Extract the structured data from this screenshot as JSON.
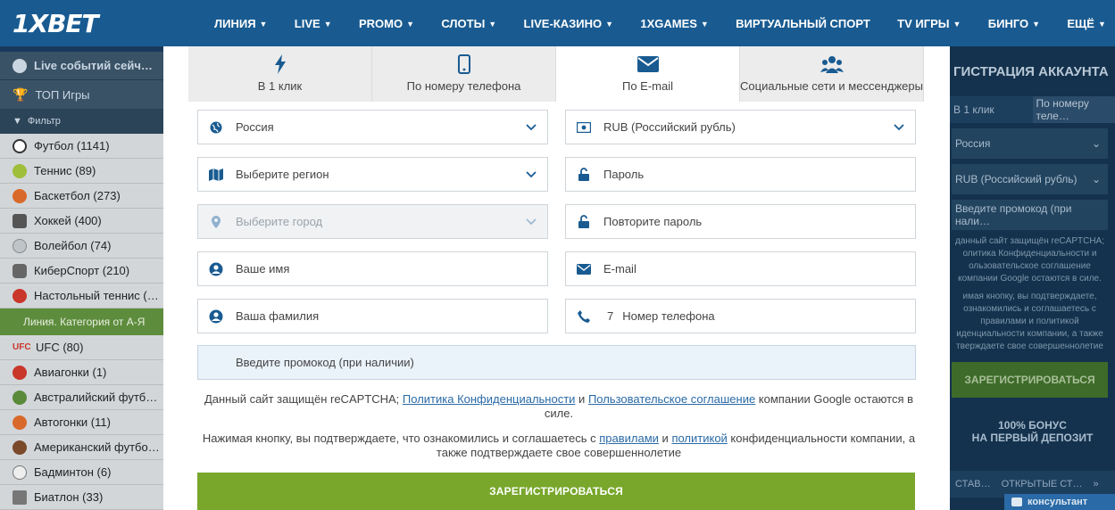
{
  "brand": {
    "logo": "1XBET"
  },
  "nav": {
    "items": [
      {
        "label": "ЛИНИЯ",
        "has_dropdown": true
      },
      {
        "label": "LIVE",
        "has_dropdown": true
      },
      {
        "label": "PROMO",
        "has_dropdown": true
      },
      {
        "label": "СЛОТЫ",
        "has_dropdown": true
      },
      {
        "label": "LIVE-КАЗИНО",
        "has_dropdown": true
      },
      {
        "label": "1XGAMES",
        "has_dropdown": true
      },
      {
        "label": "ВИРТУАЛЬНЫЙ СПОРТ",
        "has_dropdown": false
      },
      {
        "label": "TV ИГРЫ",
        "has_dropdown": true
      },
      {
        "label": "БИНГО",
        "has_dropdown": true
      },
      {
        "label": "ЕЩЁ",
        "has_dropdown": true
      }
    ]
  },
  "sidebar": {
    "live": "Live событий сейч…",
    "top": "ТОП Игры",
    "filter": "Фильтр",
    "sports": [
      "Футбол (1141)",
      "Теннис (89)",
      "Баскетбол (273)",
      "Хоккей (400)",
      "Волейбол (74)",
      "КиберСпорт (210)",
      "Настольный теннис (…"
    ],
    "category": "Линия. Категория от А-Я",
    "list": [
      "UFC (80)",
      "Авиагонки (1)",
      "Австралийский футб…",
      "Автогонки (11)",
      "Американский футбо…",
      "Бадминтон (6)",
      "Биатлон (33)"
    ]
  },
  "modal": {
    "tabs": [
      {
        "label": "В 1 клик",
        "icon": "lightning-icon"
      },
      {
        "label": "По номеру телефона",
        "icon": "phone-icon"
      },
      {
        "label": "По E-mail",
        "icon": "envelope-icon",
        "active": true
      },
      {
        "label": "Социальные сети и мессенджеры",
        "icon": "people-icon"
      }
    ],
    "fields": {
      "country": "Россия",
      "region": "Выберите регион",
      "city": "Выберите город",
      "first_name": "Ваше имя",
      "last_name": "Ваша фамилия",
      "currency": "RUB (Российский рубль)",
      "password": "Пароль",
      "password_repeat": "Повторите пароль",
      "email": "E-mail",
      "phone_prefix": "7",
      "phone": "Номер телефона",
      "promo": "Введите промокод (при наличии)"
    },
    "recaptcha": {
      "before": "Данный сайт защищён reCAPTCHA; ",
      "privacy_link": "Политика Конфиденциальности",
      "and": " и ",
      "terms_link": "Пользовательское соглашение",
      "after": " компании Google остаются в силе."
    },
    "consent": {
      "before": "Нажимая кнопку, вы подтверждаете, что ознакомились и соглашаетесь с ",
      "rules_link": "правилами",
      "and": " и ",
      "policy_link": "политикой",
      "after": " конфиденциальности компании, а также подтверждаете свое совершеннолетие"
    },
    "register": "ЗАРЕГИСТРИРОВАТЬСЯ"
  },
  "rightpanel": {
    "title": "ГИСТРАЦИЯ АККАУНТА",
    "tab1": "В 1 клик",
    "tab2": "По номеру теле…",
    "country": "Россия",
    "currency": "RUB (Российский рубль)",
    "promo": "Введите промокод (при нали…",
    "recaptcha": "данный сайт защищён reCAPTCHA; олитика Конфиденциальности и ользовательское соглашение компании Google остаются в силе.",
    "consent": "имая кнопку, вы подтверждаете, ознакомились и соглашаетесь с правилами и политикой иденциальности компании, а также тверждаете свое совершеннолетие",
    "register": "ЗАРЕГИСТРИРОВАТЬСЯ",
    "bonus_line1": "100% БОНУС",
    "bonus_line2": "НА ПЕРВЫЙ ДЕПОЗИТ",
    "ftab1": "СТАВ…",
    "ftab2": "ОТКРЫТЫЕ СТ…",
    "consultant": "консультант"
  },
  "colors": {
    "brand_blue": "#195b91",
    "register_green": "#78a72b",
    "link": "#2a6aa6"
  }
}
